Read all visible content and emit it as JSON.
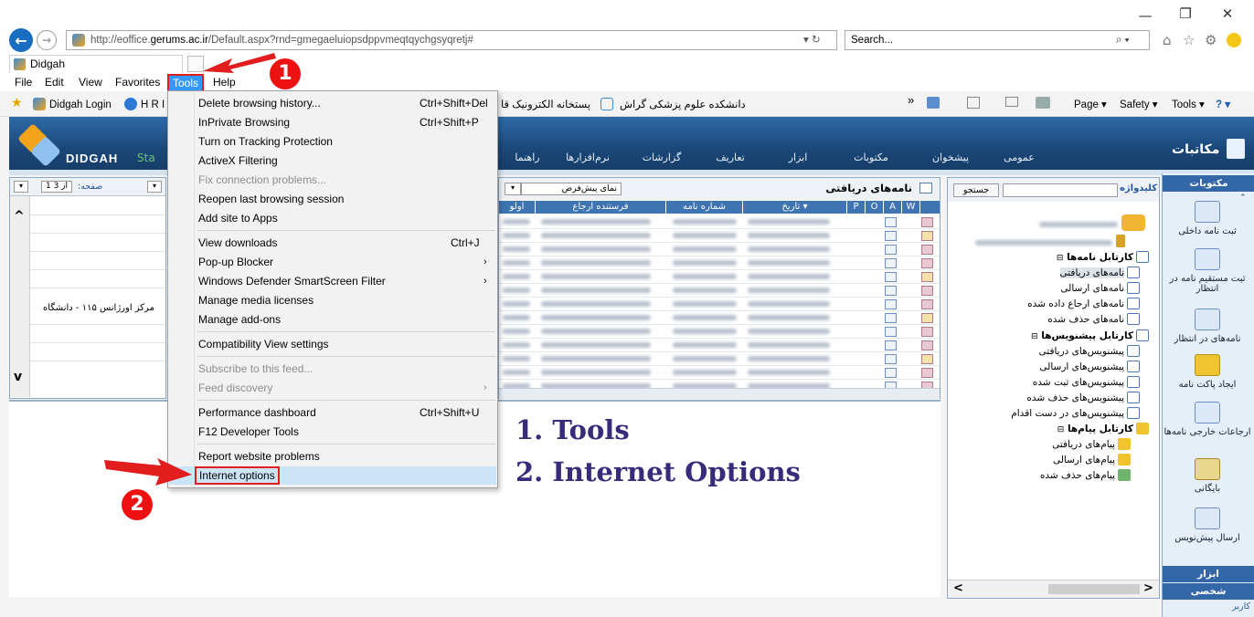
{
  "browser": {
    "url_prefix": "http://eoffice.",
    "url_domain": "gerums.ac.ir",
    "url_suffix": "/Default.aspx?rnd=gmegaeluiopsdppvmeqtqychgsyqretj#",
    "search_placeholder": "Search...",
    "tab_title": "Didgah",
    "refresh_glyph": "▾ ↻",
    "search_glyph": "⌕ ▾"
  },
  "window_controls": {
    "minimize": "—",
    "restore": "❐",
    "close": "✕"
  },
  "menubar": [
    "File",
    "Edit",
    "View",
    "Favorites",
    "Tools",
    "Help"
  ],
  "favorites": {
    "didgah_login": "Didgah Login",
    "hri": "H R I",
    "rtl_items": [
      "دانشکده علوم پزشکی گراش",
      "پستخانه الکترونیک قا"
    ],
    "overflow": "»"
  },
  "commandbar": {
    "page": "Page ▾",
    "safety": "Safety ▾",
    "tools": "Tools ▾",
    "help": "? ▾"
  },
  "tools_menu": [
    {
      "label": "Delete browsing history...",
      "shortcut": "Ctrl+Shift+Del",
      "disabled": false
    },
    {
      "label": "InPrivate Browsing",
      "shortcut": "Ctrl+Shift+P",
      "disabled": false
    },
    {
      "label": "Turn on Tracking Protection",
      "shortcut": "",
      "disabled": false
    },
    {
      "label": "ActiveX Filtering",
      "shortcut": "",
      "disabled": false
    },
    {
      "label": "Fix connection problems...",
      "shortcut": "",
      "disabled": true
    },
    {
      "label": "Reopen last browsing session",
      "shortcut": "",
      "disabled": false
    },
    {
      "label": "Add site to Apps",
      "shortcut": "",
      "disabled": false
    },
    {
      "label": "View downloads",
      "shortcut": "Ctrl+J",
      "disabled": false
    },
    {
      "label": "Pop-up Blocker",
      "shortcut": "",
      "disabled": false,
      "submenu": true
    },
    {
      "label": "Windows Defender SmartScreen Filter",
      "shortcut": "",
      "disabled": false,
      "submenu": true
    },
    {
      "label": "Manage media licenses",
      "shortcut": "",
      "disabled": false
    },
    {
      "label": "Manage add-ons",
      "shortcut": "",
      "disabled": false
    },
    {
      "label": "Compatibility View settings",
      "shortcut": "",
      "disabled": false
    },
    {
      "label": "Subscribe to this feed...",
      "shortcut": "",
      "disabled": true
    },
    {
      "label": "Feed discovery",
      "shortcut": "",
      "disabled": true,
      "submenu": true
    },
    {
      "label": "Performance dashboard",
      "shortcut": "Ctrl+Shift+U",
      "disabled": false
    },
    {
      "label": "F12 Developer Tools",
      "shortcut": "",
      "disabled": false
    },
    {
      "label": "Report website problems",
      "shortcut": "",
      "disabled": false
    },
    {
      "label": "Internet options",
      "shortcut": "",
      "disabled": false,
      "highlighted": true
    }
  ],
  "submenu_arrow": "›",
  "app": {
    "brand": "DIDGAH",
    "brand_tail": "Sta",
    "section_title": "مکاتبات",
    "nav_tabs": [
      "عمومی",
      "پیشخوان",
      "مکتوبات",
      "ابزار",
      "تعاریف",
      "گزارشات",
      "نرم‌افزارها",
      "راهنما"
    ]
  },
  "inbox": {
    "title": "نامه‌های دریافتی",
    "view_select": "نمای پیش‌فرض",
    "page_label": "صفحه:",
    "page_value": "1 از 3",
    "columns": [
      "W",
      "A",
      "O",
      "P",
      "تاریخ ▾",
      "شماره نامه",
      "فرستنده ارجاع",
      "اولو"
    ],
    "row_count": 13
  },
  "left_panel": {
    "row_text": "مرکز اورژانس ۱۱۵ - دانشگاه",
    "up_arrow": "^",
    "down_arrow": "v"
  },
  "tree": {
    "keyword_label": "کلیدواژه",
    "search_button": "جستجو",
    "letters_folder": "کارتابل نامه‌ها",
    "letters": [
      "نامه‌های دریافتی",
      "نامه‌های ارسالی",
      "نامه‌های ارجاع داده شده",
      "نامه‌های حذف شده"
    ],
    "drafts_folder": "کارتابل پیشنویس‌ها",
    "drafts": [
      "پیشنویس‌های دریافتی",
      "پیشنویس‌های ارسالی",
      "پیشنویس‌های ثبت شده",
      "پیشنویس‌های حذف شده",
      "پیشنویس‌های در دست اقدام"
    ],
    "messages_folder": "کارتابل پیام‌ها",
    "messages": [
      "پیام‌های دریافتی",
      "پیام‌های ارسالی",
      "پیام‌های حذف شده"
    ],
    "scroll_left": "<",
    "scroll_right": ">"
  },
  "sidebar": {
    "header": "مکتوبات",
    "items": [
      "ثبت نامه داخلی",
      "ثبت مستقیم نامه در انتظار",
      "نامه‌های در انتظار",
      "ایجاد پاکت نامه",
      "ارجاعات خارجی نامه‌ها",
      "بایگانی",
      "ارسال پیش‌نویس"
    ],
    "tools": "ابزار",
    "personal": "شخصی",
    "user": "کاربر"
  },
  "annotations": {
    "step1": "1. Tools",
    "step2": "2. Internet Options",
    "badge1": "1",
    "badge2": "2"
  },
  "colors": {
    "accent": "#e11d1d",
    "app_header": "#1a4777",
    "menu_highlight": "#3399ff"
  }
}
